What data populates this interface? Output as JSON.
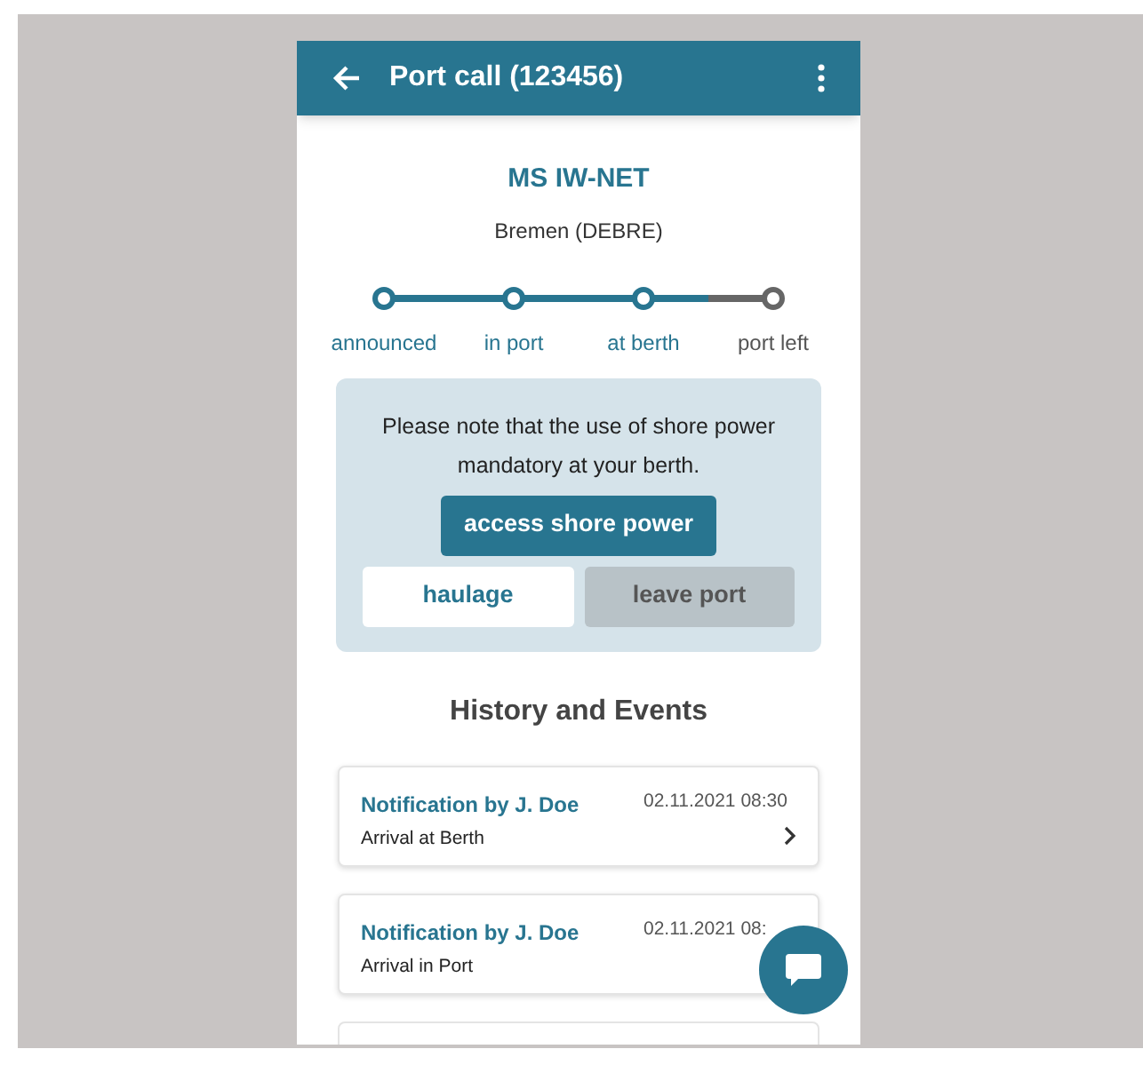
{
  "app_bar": {
    "title": "Port call (123456)"
  },
  "vessel": {
    "name": "MS IW-NET",
    "port": "Bremen (DEBRE)"
  },
  "steps": [
    {
      "label": "announced",
      "reached": true
    },
    {
      "label": "in port",
      "reached": true
    },
    {
      "label": "at berth",
      "reached": true
    },
    {
      "label": "port left",
      "reached": false
    }
  ],
  "notice": {
    "text": "Please note that the use of shore power mandatory at your berth.",
    "buttons": [
      {
        "label": "access shore power",
        "kind": "primary"
      },
      {
        "label": "haulage",
        "kind": "secondary"
      },
      {
        "label": "leave port",
        "kind": "disabled"
      }
    ]
  },
  "history": {
    "title": "History and Events",
    "events": [
      {
        "title": "Notification by J. Doe",
        "time": "02.11.2021 08:30",
        "description": "Arrival at Berth",
        "chevron": true
      },
      {
        "title": "Notification by J. Doe",
        "time": "02.11.2021 08:",
        "description": "Arrival in Port"
      }
    ]
  }
}
